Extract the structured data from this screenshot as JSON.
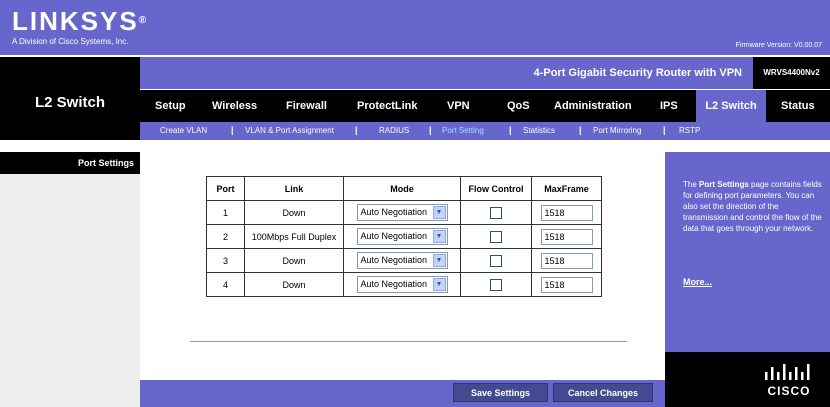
{
  "brand": {
    "logo": "LINKSYS",
    "reg_mark": "®",
    "subtitle": "A Division of Cisco Systems, Inc.",
    "firmware": "Firmware Version: V0.00.07"
  },
  "header": {
    "section_title": "L2 Switch",
    "model_name": "4-Port Gigabit Security Router with VPN",
    "model_id": "WRVS4400Nv2"
  },
  "tabs": [
    "Setup",
    "Wireless",
    "Firewall",
    "ProtectLink",
    "VPN",
    "QoS",
    "Administration",
    "IPS",
    "L2 Switch",
    "Status"
  ],
  "subtabs": [
    "Create VLAN",
    "VLAN & Port Assignment",
    "RADIUS",
    "Port Setting",
    "Statistics",
    "Port Mirroring",
    "RSTP"
  ],
  "sidebar": {
    "label": "Port Settings"
  },
  "table": {
    "headers": [
      "Port",
      "Link",
      "Mode",
      "Flow Control",
      "MaxFrame"
    ],
    "rows": [
      {
        "port": "1",
        "link": "Down",
        "mode": "Auto Negotiation",
        "max": "1518"
      },
      {
        "port": "2",
        "link": "100Mbps Full Duplex",
        "mode": "Auto Negotiation",
        "max": "1518"
      },
      {
        "port": "3",
        "link": "Down",
        "mode": "Auto Negotiation",
        "max": "1518"
      },
      {
        "port": "4",
        "link": "Down",
        "mode": "Auto Negotiation",
        "max": "1518"
      }
    ]
  },
  "help": {
    "intro": "The ",
    "bold": "Port Settings",
    "rest": " page contains fields for defining port parameters. You can also set the direction of the transmission and control the flow of the data that goes through your network.",
    "more": "More..."
  },
  "buttons": {
    "save": "Save Settings",
    "cancel": "Cancel Changes"
  },
  "cisco": {
    "word": "CISCO"
  },
  "colors": {
    "brand_purple": "#6666cc",
    "active_subtab": "#aaddff",
    "button": "#434a8f"
  }
}
